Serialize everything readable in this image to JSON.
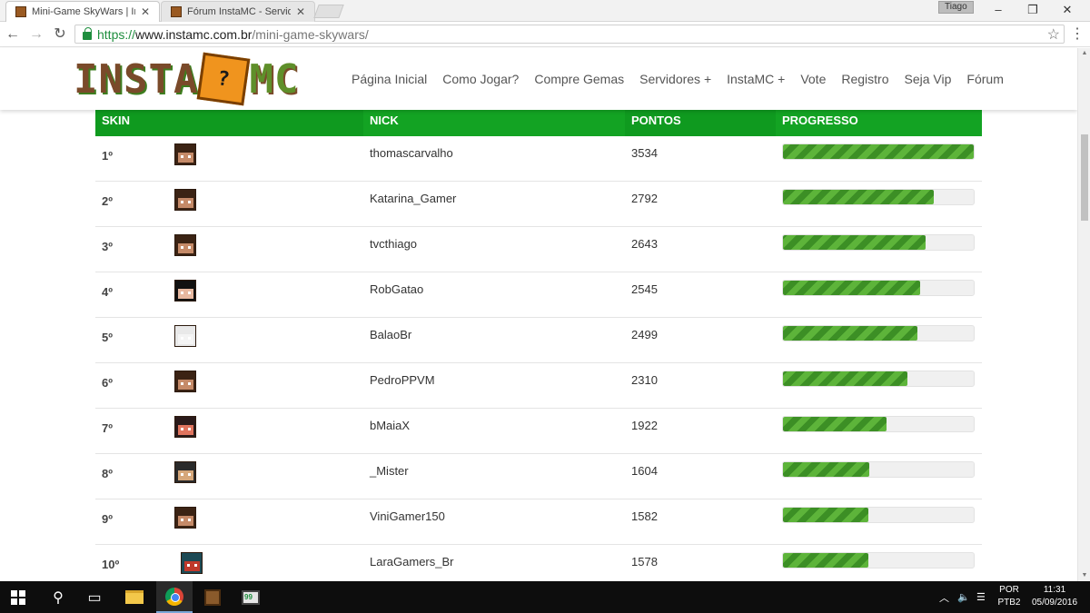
{
  "browser": {
    "tabs": [
      {
        "title": "Mini-Game SkyWars | Inst",
        "active": true
      },
      {
        "title": "Fórum InstaMC - Servidor",
        "active": false
      }
    ],
    "profile_name": "Tiago",
    "url_protocol": "https://",
    "url_host": "www.instamc.com.br",
    "url_path": "/mini-game-skywars/"
  },
  "site": {
    "logo_left": "INSTA",
    "logo_block": "?",
    "logo_right": "MC",
    "nav": [
      "Página Inicial",
      "Como Jogar?",
      "Compre Gemas",
      "Servidores +",
      "InstaMC +",
      "Vote",
      "Registro",
      "Seja Vip",
      "Fórum"
    ]
  },
  "table": {
    "headers": {
      "skin": "SKIN",
      "nick": "NICK",
      "points": "PONTOS",
      "progress": "PROGRESSO"
    },
    "rows": [
      {
        "pos": "1º",
        "nick": "thomascarvalho",
        "points": "3534",
        "progress": 1.0,
        "skin": "brown-hair"
      },
      {
        "pos": "2º",
        "nick": "Katarina_Gamer",
        "points": "2792",
        "progress": 0.79,
        "skin": "brown-hair"
      },
      {
        "pos": "3º",
        "nick": "tvcthiago",
        "points": "2643",
        "progress": 0.748,
        "skin": "brown-hair"
      },
      {
        "pos": "4º",
        "nick": "RobGatao",
        "points": "2545",
        "progress": 0.72,
        "skin": "black-hair"
      },
      {
        "pos": "5º",
        "nick": "BalaoBr",
        "points": "2499",
        "progress": 0.707,
        "skin": "white-chicken"
      },
      {
        "pos": "6º",
        "nick": "PedroPPVM",
        "points": "2310",
        "progress": 0.654,
        "skin": "brown-hair"
      },
      {
        "pos": "7º",
        "nick": "bMaiaX",
        "points": "1922",
        "progress": 0.544,
        "skin": "red-black"
      },
      {
        "pos": "8º",
        "nick": "_Mister",
        "points": "1604",
        "progress": 0.454,
        "skin": "halo-yellow"
      },
      {
        "pos": "9º",
        "nick": "ViniGamer150",
        "points": "1582",
        "progress": 0.448,
        "skin": "brown-hair"
      },
      {
        "pos": "10º",
        "nick": "LaraGamers_Br",
        "points": "1578",
        "progress": 0.447,
        "skin": "teal-red"
      }
    ]
  },
  "skin_colors": {
    "brown-hair": {
      "hair": "#3b2314",
      "face": "#c58a68"
    },
    "black-hair": {
      "hair": "#111111",
      "face": "#e7b8a0"
    },
    "white-chicken": {
      "hair": "#e9e9e9",
      "face": "#f4f4f4"
    },
    "red-black": {
      "hair": "#2a1a1a",
      "face": "#e0745e"
    },
    "halo-yellow": {
      "hair": "#2a2a2a",
      "face": "#d6a77a"
    },
    "teal-red": {
      "hair": "#1d4a55",
      "face": "#c0392b"
    }
  },
  "taskbar": {
    "ime_line1": "POR",
    "ime_line2": "PTB2",
    "time": "11:31",
    "date": "05/09/2016"
  },
  "colors": {
    "header_green": "#119e22",
    "bar_light": "#5db43a",
    "bar_dark": "#3c8f25"
  }
}
